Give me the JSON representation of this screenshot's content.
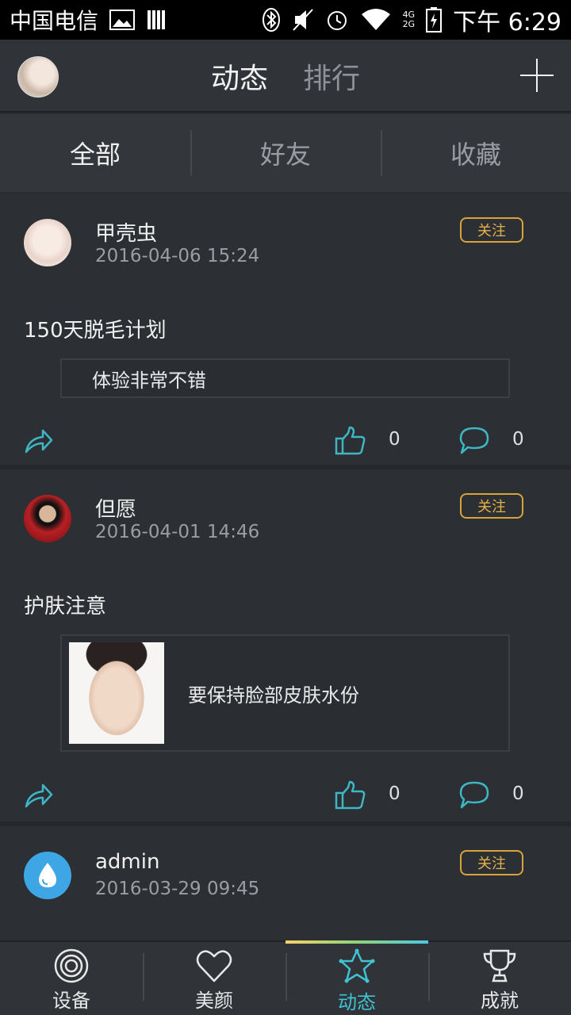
{
  "status_bar": {
    "carrier": "中国电信",
    "network_4g": "4G",
    "network_2g": "2G",
    "time": "下午 6:29"
  },
  "header": {
    "tabs": [
      {
        "label": "动态",
        "active": true
      },
      {
        "label": "排行",
        "active": false
      }
    ],
    "add_icon": "plus-icon"
  },
  "filters": [
    {
      "label": "全部",
      "active": true
    },
    {
      "label": "好友",
      "active": false
    },
    {
      "label": "收藏",
      "active": false
    }
  ],
  "posts": [
    {
      "user": "甲壳虫",
      "time": "2016-04-06 15:24",
      "follow_label": "关注",
      "title": "150天脱毛计划",
      "card_text": "体验非常不错",
      "likes": "0",
      "comments": "0"
    },
    {
      "user": "但愿",
      "time": "2016-04-01 14:46",
      "follow_label": "关注",
      "title": "护肤注意",
      "card_text": "要保持脸部皮肤水份",
      "likes": "0",
      "comments": "0"
    },
    {
      "user": "admin",
      "time": "2016-03-29 09:45",
      "follow_label": "关注"
    }
  ],
  "bottom_nav": [
    {
      "label": "设备",
      "icon": "device-icon",
      "active": false
    },
    {
      "label": "美颜",
      "icon": "heart-icon",
      "active": false
    },
    {
      "label": "动态",
      "icon": "star-network-icon",
      "active": true
    },
    {
      "label": "成就",
      "icon": "trophy-icon",
      "active": false
    }
  ],
  "colors": {
    "accent": "#3fc3d3",
    "follow": "#d7a33a",
    "background": "#2a2d31"
  }
}
